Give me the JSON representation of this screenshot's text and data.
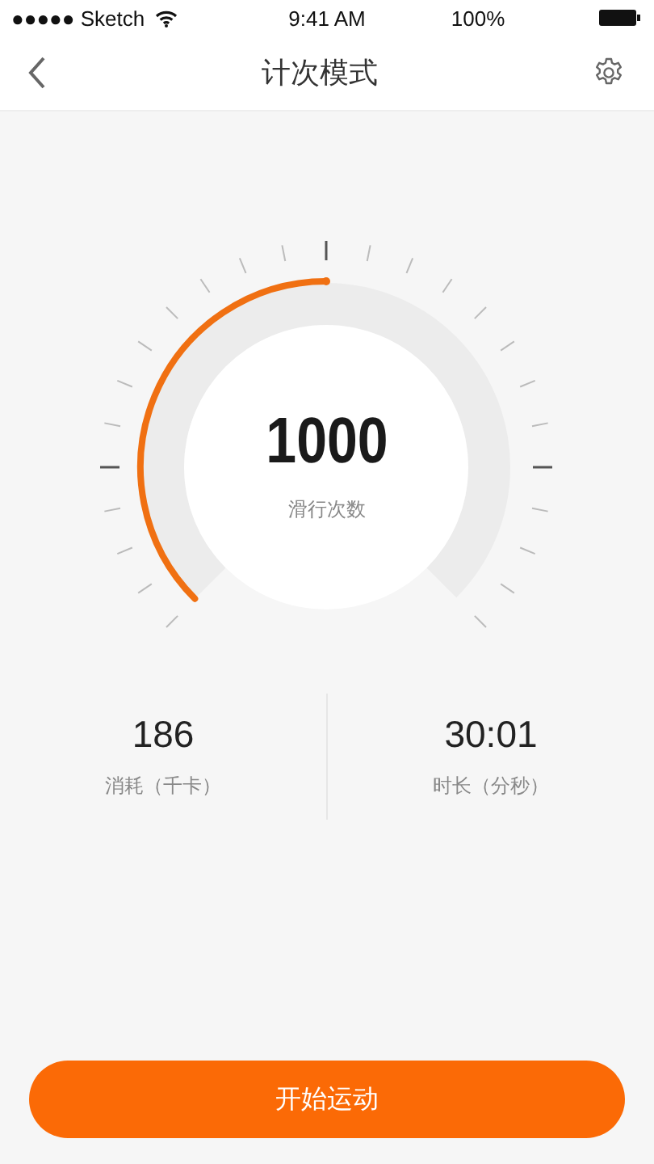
{
  "status_bar": {
    "carrier": "●●●●● Sketch",
    "time": "9:41 AM",
    "battery": "100%"
  },
  "nav": {
    "title": "计次模式"
  },
  "gauge": {
    "value": "1000",
    "label": "滑行次数"
  },
  "stats": [
    {
      "value": "186",
      "label": "消耗（千卡）"
    },
    {
      "value": "30:01",
      "label": "时长（分秒）"
    }
  ],
  "start_button": "开始运动"
}
